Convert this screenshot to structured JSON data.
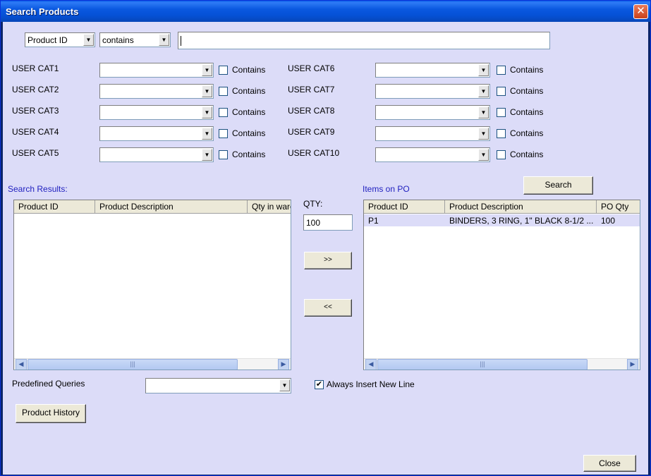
{
  "window": {
    "title": "Search Products",
    "close_glyph": "✕"
  },
  "filter": {
    "field": "Product ID",
    "operator": "contains",
    "value": ""
  },
  "user_cats_left": [
    {
      "label": "USER CAT1",
      "value": "",
      "contains_label": "Contains",
      "contains_checked": false
    },
    {
      "label": "USER CAT2",
      "value": "",
      "contains_label": "Contains",
      "contains_checked": false
    },
    {
      "label": "USER CAT3",
      "value": "",
      "contains_label": "Contains",
      "contains_checked": false
    },
    {
      "label": "USER CAT4",
      "value": "",
      "contains_label": "Contains",
      "contains_checked": false
    },
    {
      "label": "USER CAT5",
      "value": "",
      "contains_label": "Contains",
      "contains_checked": false
    }
  ],
  "user_cats_right": [
    {
      "label": "USER CAT6",
      "value": "",
      "contains_label": "Contains",
      "contains_checked": false
    },
    {
      "label": "USER CAT7",
      "value": "",
      "contains_label": "Contains",
      "contains_checked": false
    },
    {
      "label": "USER CAT8",
      "value": "",
      "contains_label": "Contains",
      "contains_checked": false
    },
    {
      "label": "USER CAT9",
      "value": "",
      "contains_label": "Contains",
      "contains_checked": false
    },
    {
      "label": "USER CAT10",
      "value": "",
      "contains_label": "Contains",
      "contains_checked": false
    }
  ],
  "search_button": "Search",
  "search_results": {
    "label": "Search Results:",
    "columns": [
      "Product ID",
      "Product Description",
      "Qty in ware"
    ],
    "rows": []
  },
  "qty": {
    "label": "QTY:",
    "value": "100",
    "add_label": ">>",
    "remove_label": "<<"
  },
  "items_on_po": {
    "label": "Items on PO",
    "columns": [
      "Product ID",
      "Product Description",
      "PO Qty"
    ],
    "rows": [
      {
        "product_id": "P1",
        "description": "BINDERS, 3 RING, 1\" BLACK 8-1/2 ...",
        "po_qty": "100"
      }
    ]
  },
  "predefined_queries": {
    "label": "Predefined Queries",
    "value": ""
  },
  "always_insert": {
    "label": "Always Insert New Line",
    "checked": true
  },
  "product_history_button": "Product History",
  "close_button": "Close",
  "glyphs": {
    "dropdown_arrow": "▼",
    "scroll_left": "◀",
    "scroll_right": "▶",
    "thumb_grip": "|||",
    "check": "✔"
  },
  "colors": {
    "client_bg": "#dcdcf8",
    "title_blue": "#0551d6",
    "label_blue": "#1f1fbf",
    "selected_row": "#dcdcf8"
  }
}
